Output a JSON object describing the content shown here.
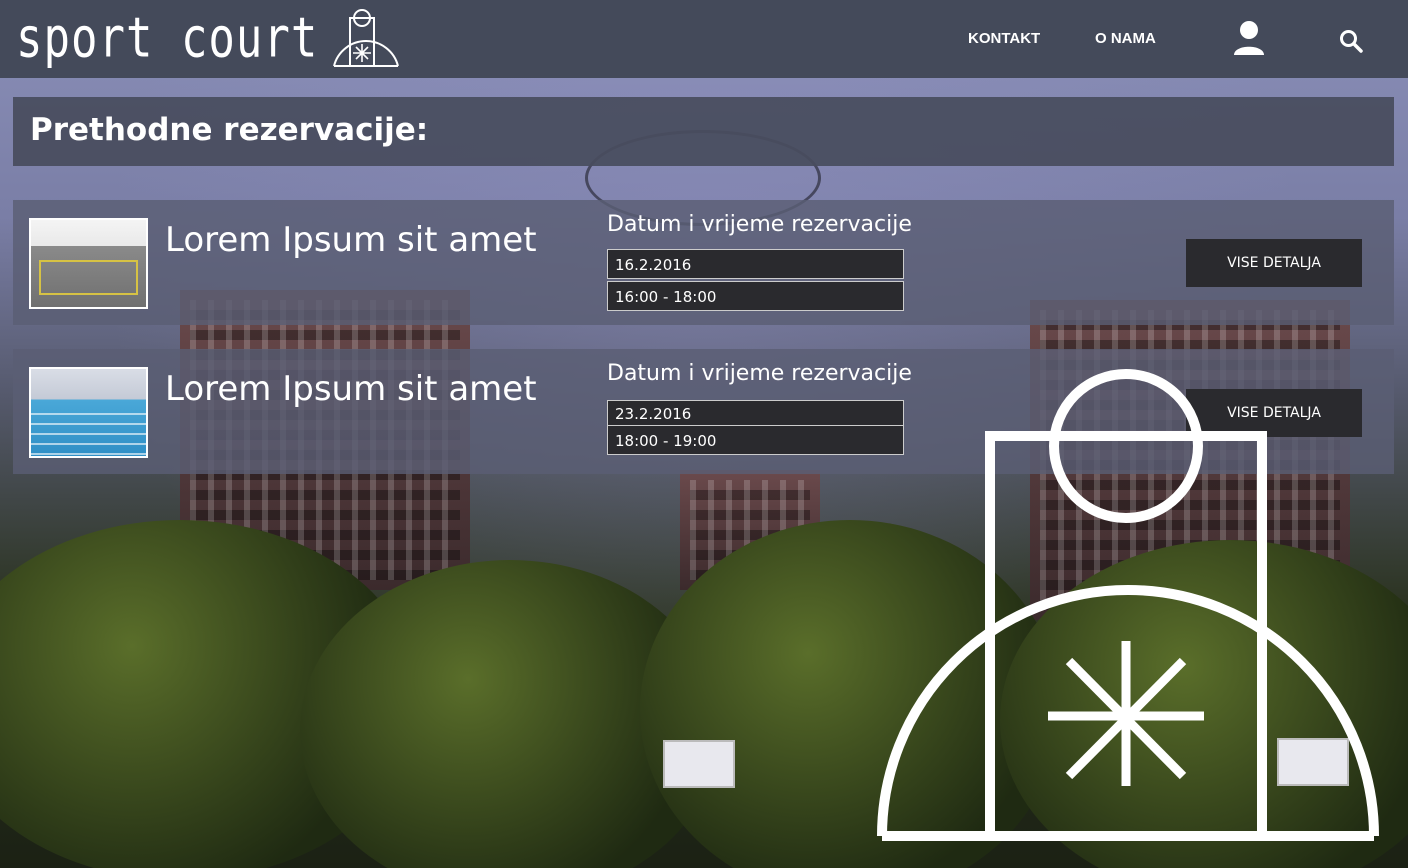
{
  "header": {
    "logo_text": "sport court",
    "nav": [
      {
        "label": "KONTAKT"
      },
      {
        "label": "O NAMA"
      }
    ]
  },
  "page": {
    "title": "Prethodne rezervacije:"
  },
  "reservations": [
    {
      "name": "Lorem Ipsum sit amet",
      "datetime_label": "Datum i vrijeme rezervacije",
      "date": "16.2.2016",
      "time": "16:00 - 18:00",
      "button_label": "VISE DETALJA",
      "thumb": "indoor-court"
    },
    {
      "name": "Lorem Ipsum sit amet",
      "datetime_label": "Datum i vrijeme rezervacije",
      "date": "23.2.2016",
      "time": "18:00 - 19:00",
      "button_label": "VISE DETALJA",
      "thumb": "swimming-pool"
    }
  ],
  "icons": {
    "user": "user-icon",
    "search": "search-icon",
    "logo_mark": "court-logo-icon"
  },
  "colors": {
    "header_bg": "#444a5a",
    "button_bg": "#2a2a2e"
  }
}
